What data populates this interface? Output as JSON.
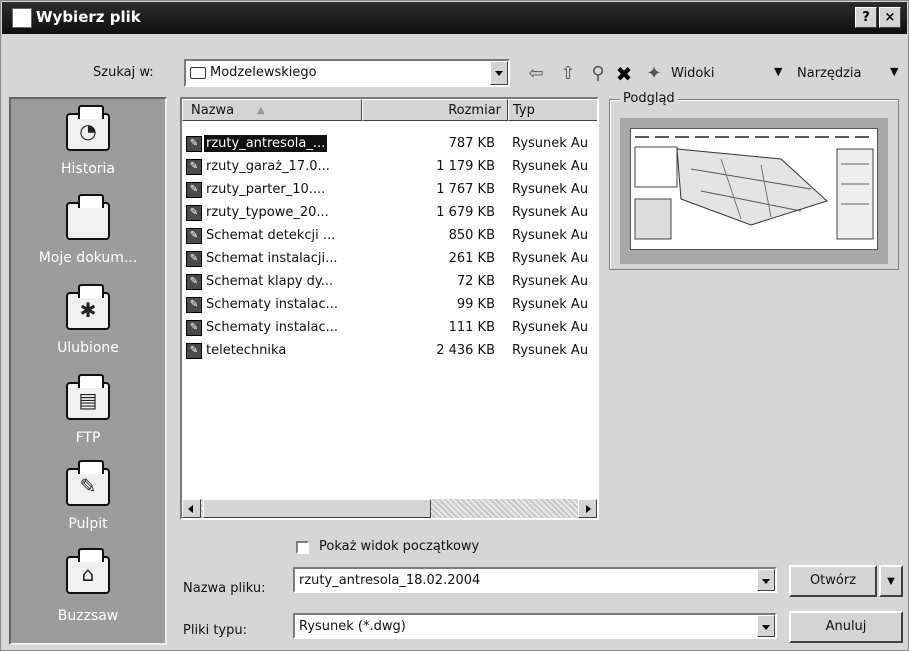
{
  "window": {
    "title": "Wybierz plik",
    "help_label": "?",
    "close_label": "×"
  },
  "toolbar": {
    "look_in_label": "Szukaj w:",
    "look_in_value": "Modzelewskiego",
    "views_label": "Widoki",
    "tools_label": "Narzędzia"
  },
  "places": [
    {
      "label": "Historia",
      "icon": "history-icon"
    },
    {
      "label": "Moje dokum...",
      "icon": "my-documents-icon"
    },
    {
      "label": "Ulubione",
      "icon": "favorites-icon"
    },
    {
      "label": "FTP",
      "icon": "ftp-icon"
    },
    {
      "label": "Pulpit",
      "icon": "desktop-icon"
    },
    {
      "label": "Buzzsaw",
      "icon": "buzzsaw-icon"
    }
  ],
  "file_list": {
    "columns": {
      "name": "Nazwa",
      "size": "Rozmiar",
      "type": "Typ"
    },
    "rows": [
      {
        "name": "rzuty_antresola_...",
        "size": "787 KB",
        "type": "Rysunek Au",
        "selected": true
      },
      {
        "name": "rzuty_garaż_17.0...",
        "size": "1 179 KB",
        "type": "Rysunek Au"
      },
      {
        "name": "rzuty_parter_10....",
        "size": "1 767 KB",
        "type": "Rysunek Au"
      },
      {
        "name": "rzuty_typowe_20...",
        "size": "1 679 KB",
        "type": "Rysunek Au"
      },
      {
        "name": "Schemat detekcji ...",
        "size": "850 KB",
        "type": "Rysunek Au"
      },
      {
        "name": "Schemat instalacji...",
        "size": "261 KB",
        "type": "Rysunek Au"
      },
      {
        "name": "Schemat klapy dy...",
        "size": "72 KB",
        "type": "Rysunek Au"
      },
      {
        "name": "Schematy instalac...",
        "size": "99 KB",
        "type": "Rysunek Au"
      },
      {
        "name": "Schematy instalac...",
        "size": "111 KB",
        "type": "Rysunek Au"
      },
      {
        "name": "teletechnika",
        "size": "2 436 KB",
        "type": "Rysunek Au"
      }
    ]
  },
  "preview": {
    "label": "Podgląd"
  },
  "show_initial_view": {
    "label": "Pokaż widok początkowy",
    "checked": false
  },
  "file_name": {
    "label": "Nazwa pliku:",
    "value": "rzuty_antresola_18.02.2004"
  },
  "file_type": {
    "label": "Pliki typu:",
    "value": "Rysunek (*.dwg)"
  },
  "buttons": {
    "open": "Otwórz",
    "cancel": "Anuluj"
  }
}
